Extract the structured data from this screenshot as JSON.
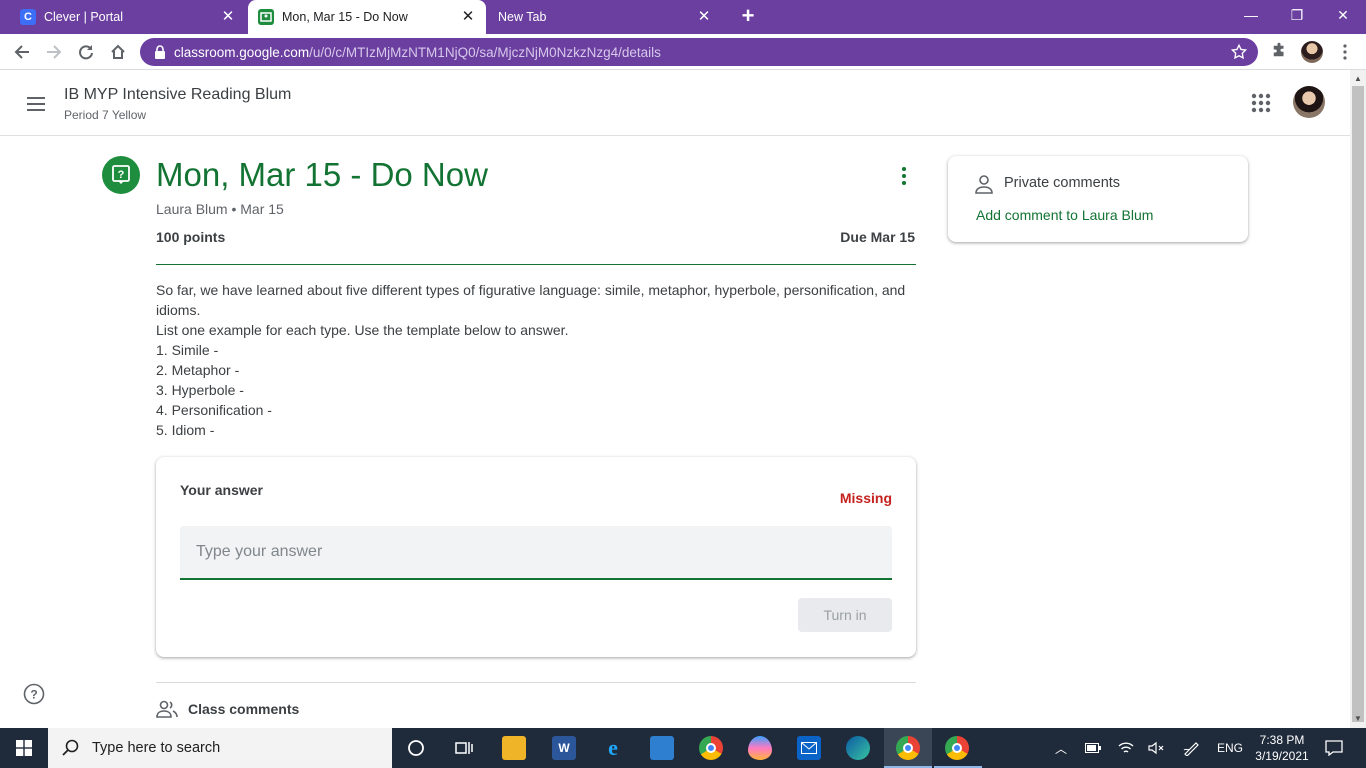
{
  "browser": {
    "tabs": [
      {
        "title": "Clever | Portal",
        "favicon": "C"
      },
      {
        "title": "Mon, Mar 15 - Do Now"
      },
      {
        "title": "New Tab"
      }
    ],
    "url_host": "classroom.google.com",
    "url_path": "/u/0/c/MTIzMjMzNTM1NjQ0/sa/MjczNjM0NzkzNzg4/details",
    "accent_color": "#6b3fa0"
  },
  "header": {
    "class_name": "IB MYP Intensive Reading Blum",
    "section": "Period 7 Yellow"
  },
  "assignment": {
    "title": "Mon, Mar 15 - Do Now",
    "meta": "Laura Blum • Mar 15",
    "points": "100 points",
    "due": "Due Mar 15",
    "description": [
      "So far, we have learned about five different types of figurative language: simile, metaphor, hyperbole, personification, and idioms.",
      "List one example for each type. Use the template below to answer.",
      "1. Simile -",
      "2. Metaphor -",
      "3. Hyperbole -",
      "4. Personification -",
      "5. Idiom -"
    ],
    "theme_color": "#137333"
  },
  "answer": {
    "label": "Your answer",
    "status": "Missing",
    "placeholder": "Type your answer",
    "value": "",
    "turn_in_label": "Turn in"
  },
  "private_comments": {
    "title": "Private comments",
    "add_label": "Add comment to Laura Blum"
  },
  "class_comments": {
    "title": "Class comments"
  },
  "taskbar": {
    "search_placeholder": "Type here to search",
    "language": "ENG",
    "time": "7:38 PM",
    "date": "3/19/2021",
    "apps": [
      "cortana-icon",
      "task-view-icon",
      "file-explorer-icon",
      "word-icon",
      "internet-explorer-icon",
      "photos-icon",
      "chrome-icon",
      "paint-icon",
      "mail-icon",
      "edge-icon",
      "chrome-profile-icon",
      "chrome-profile-2-icon"
    ]
  }
}
